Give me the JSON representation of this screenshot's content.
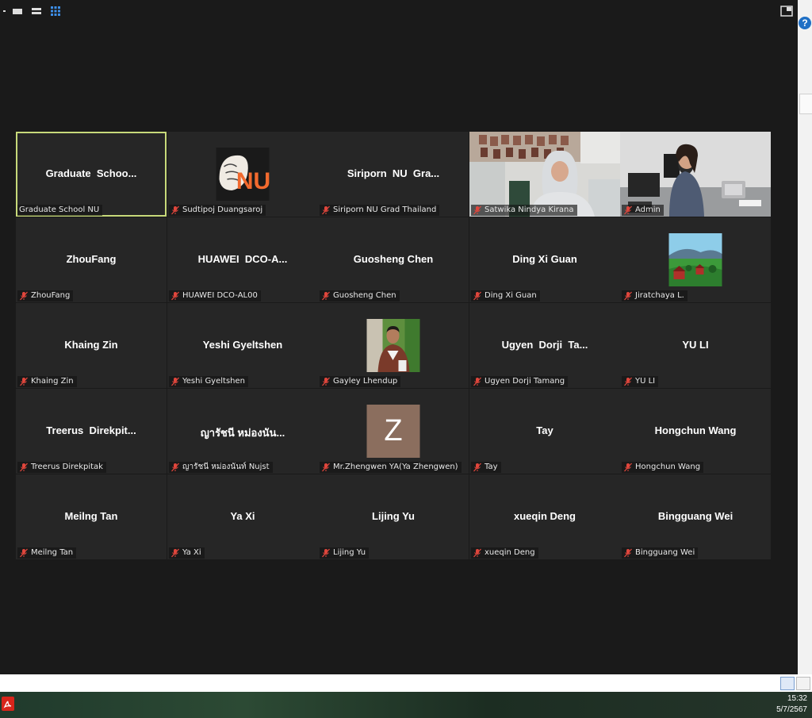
{
  "window": {
    "view_icons": [
      "minimize-icon",
      "speaker-view-icon",
      "stacked-view-icon",
      "gallery-view-icon"
    ],
    "fullscreen_icon": "exit-fullscreen-icon",
    "help_label": "?"
  },
  "participants": [
    {
      "display": "Graduate  Schoo...",
      "name": "Graduate School NU",
      "muted": false,
      "active": true,
      "kind": "text"
    },
    {
      "display": "",
      "name": "Sudtipoj Duangsaroj",
      "muted": true,
      "kind": "logo",
      "logo_text": "NU"
    },
    {
      "display": "Siriporn  NU  Gra...",
      "name": "Siriporn NU Grad Thailand",
      "muted": true,
      "kind": "text"
    },
    {
      "display": "",
      "name": "Satwika Nindya Kirana",
      "muted": true,
      "kind": "video"
    },
    {
      "display": "",
      "name": "Admin",
      "muted": true,
      "kind": "video"
    },
    {
      "display": "ZhouFang",
      "name": "ZhouFang",
      "muted": true,
      "kind": "text"
    },
    {
      "display": "HUAWEI  DCO-A...",
      "name": "HUAWEI DCO-AL00",
      "muted": true,
      "kind": "text"
    },
    {
      "display": "Guosheng Chen",
      "name": "Guosheng Chen",
      "muted": true,
      "kind": "text"
    },
    {
      "display": "Ding Xi Guan",
      "name": "Ding Xi Guan",
      "muted": true,
      "kind": "text"
    },
    {
      "display": "",
      "name": "Jiratchaya L.",
      "muted": true,
      "kind": "landscape"
    },
    {
      "display": "Khaing Zin",
      "name": "Khaing Zin",
      "muted": true,
      "kind": "text"
    },
    {
      "display": "Yeshi Gyeltshen",
      "name": "Yeshi Gyeltshen",
      "muted": true,
      "kind": "text"
    },
    {
      "display": "",
      "name": "Gayley Lhendup",
      "muted": true,
      "kind": "photo"
    },
    {
      "display": "Ugyen  Dorji  Ta...",
      "name": "Ugyen Dorji Tamang",
      "muted": true,
      "kind": "text"
    },
    {
      "display": "YU LI",
      "name": "YU LI",
      "muted": true,
      "kind": "text"
    },
    {
      "display": "Treerus  Direkpit...",
      "name": "Treerus Direkpitak",
      "muted": true,
      "kind": "text"
    },
    {
      "display": "ญารัชนี หม่องนัน...",
      "name": "ญารัชนี หม่องนันท์ Nujst",
      "muted": true,
      "kind": "text"
    },
    {
      "display": "",
      "name": "Mr.Zhengwen YA(Ya Zhengwen)",
      "muted": true,
      "kind": "initial",
      "initial": "Z"
    },
    {
      "display": "Tay",
      "name": "Tay",
      "muted": true,
      "kind": "text"
    },
    {
      "display": "Hongchun Wang",
      "name": "Hongchun Wang",
      "muted": true,
      "kind": "text"
    },
    {
      "display": "Meilng Tan",
      "name": "Meilng Tan",
      "muted": true,
      "kind": "text"
    },
    {
      "display": "Ya Xi",
      "name": "Ya Xi",
      "muted": true,
      "kind": "text"
    },
    {
      "display": "Lijing Yu",
      "name": "Lijing Yu",
      "muted": true,
      "kind": "text"
    },
    {
      "display": "xueqin Deng",
      "name": "xueqin Deng",
      "muted": true,
      "kind": "text"
    },
    {
      "display": "Bingguang Wei",
      "name": "Bingguang Wei",
      "muted": true,
      "kind": "text"
    }
  ],
  "colors": {
    "active_border": "#c7d97a",
    "muted_mic": "#e0463c",
    "initial_avatar": "#8b6e5e"
  },
  "taskbar": {
    "time": "15:32",
    "date": "5/7/2567",
    "app_icon": "adobe-acrobat-icon"
  }
}
